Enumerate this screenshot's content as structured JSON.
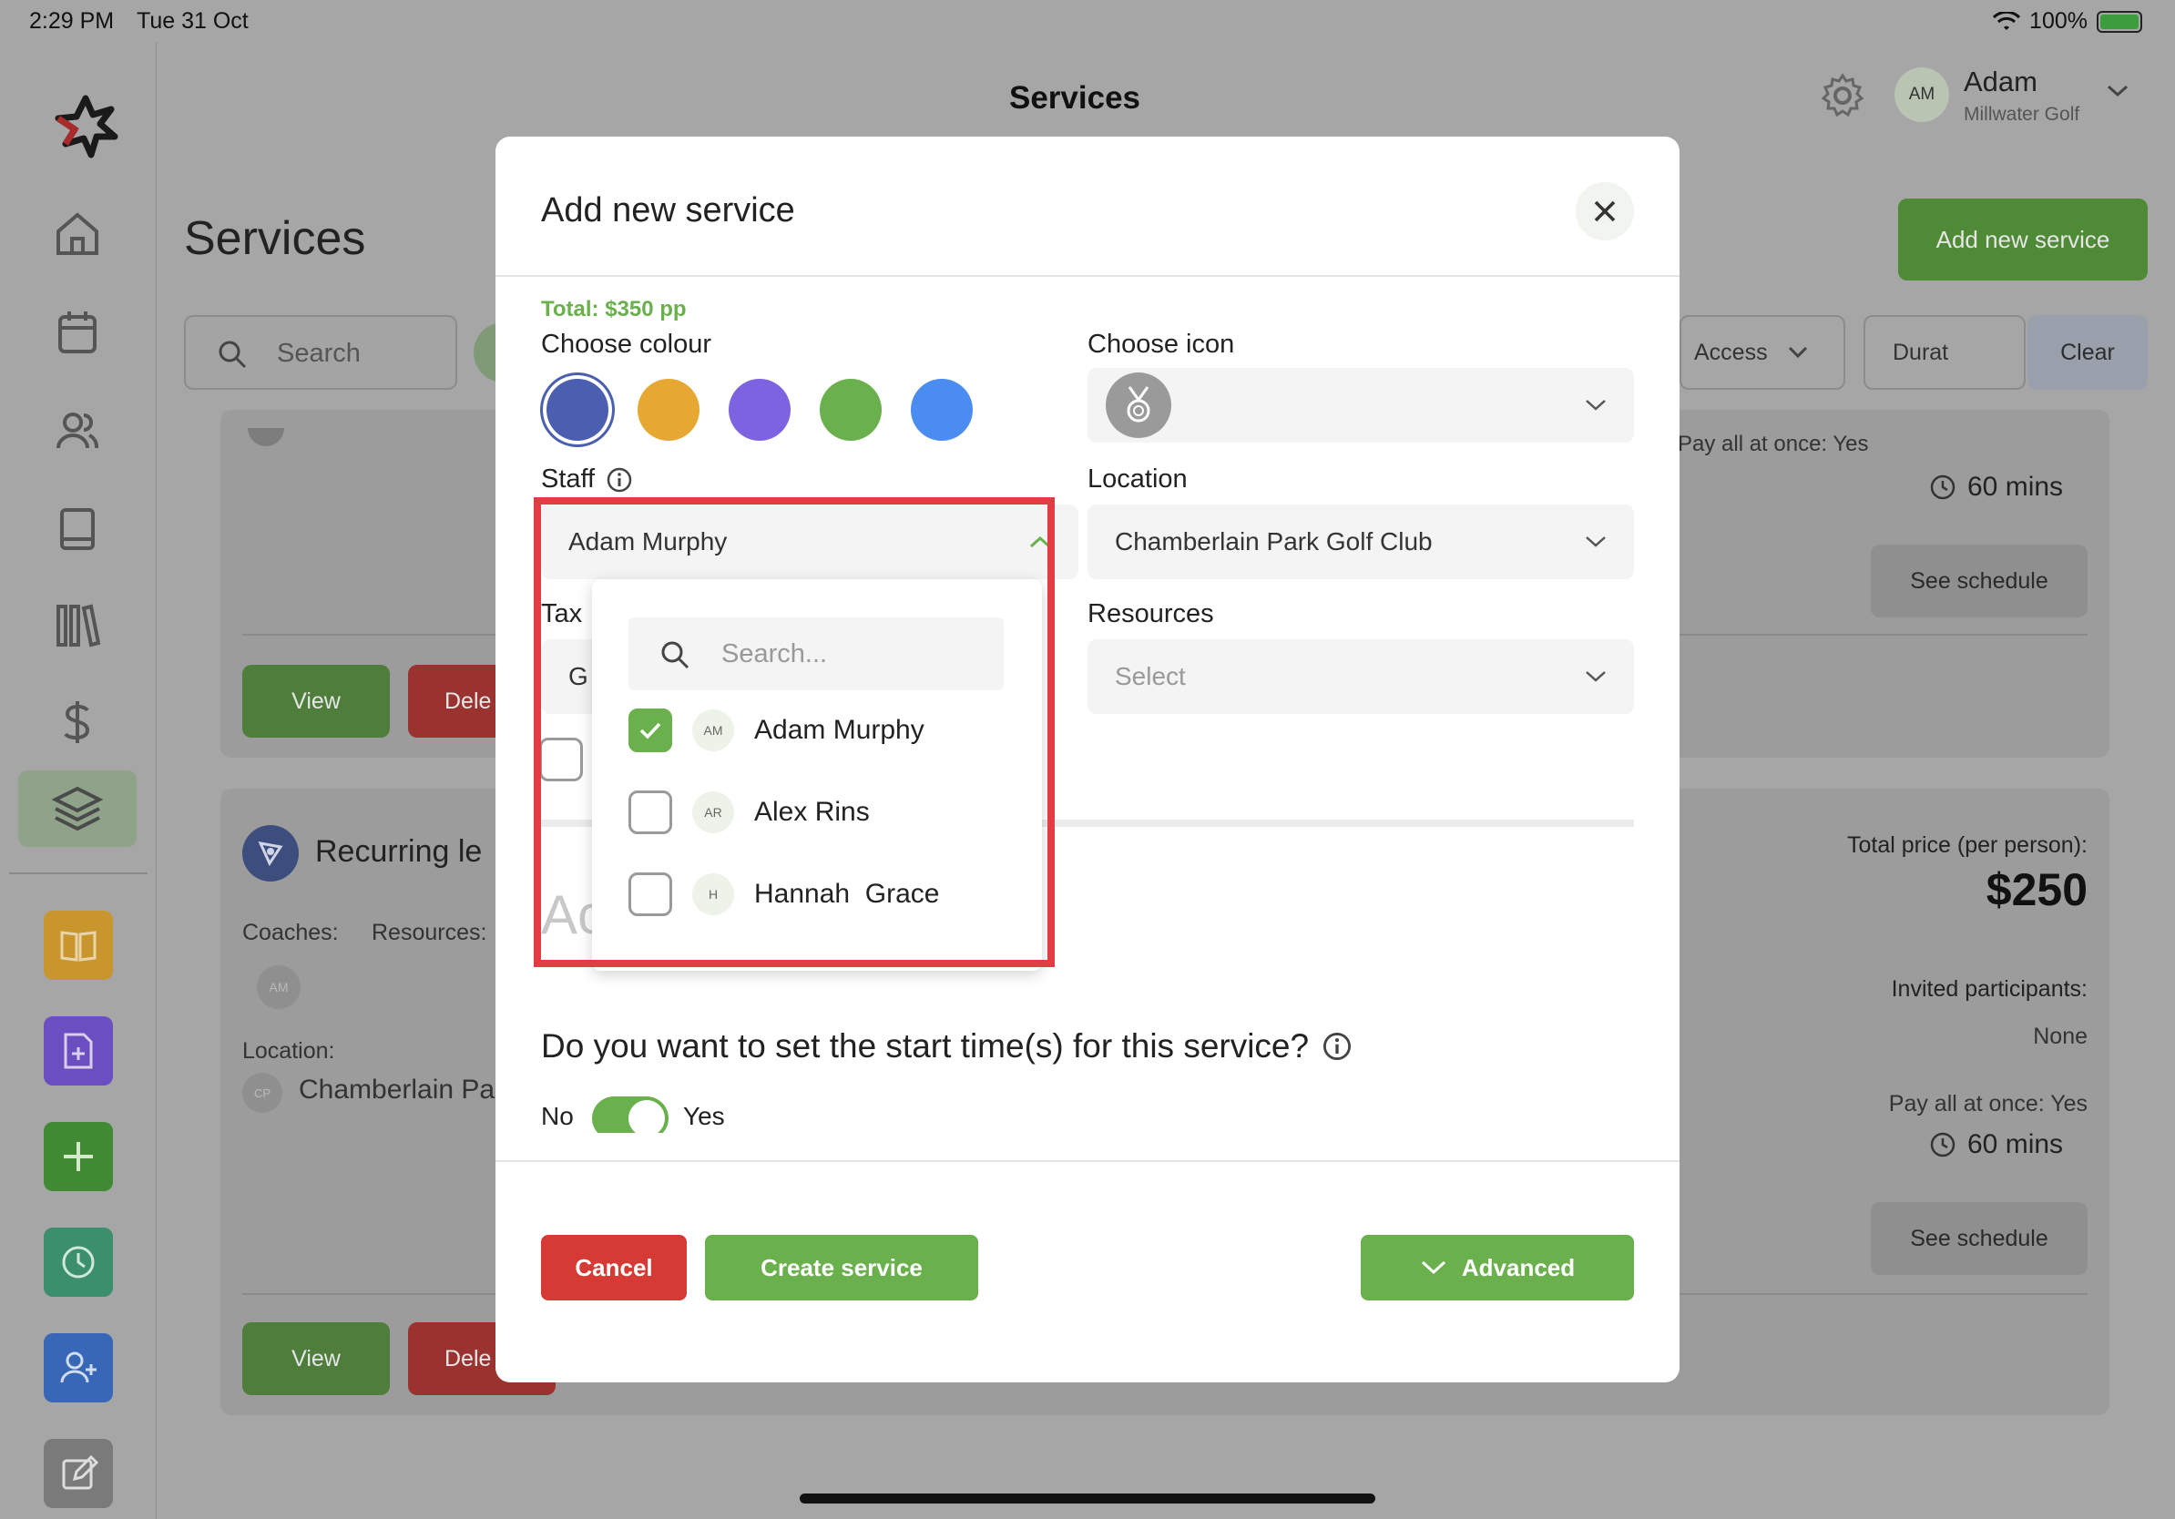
{
  "status_bar": {
    "time": "2:29 PM",
    "date": "Tue 31 Oct",
    "battery": "100%"
  },
  "sidebar": {
    "items": [
      "home-icon",
      "calendar-icon",
      "users-icon",
      "book-icon",
      "library-icon",
      "dollar-icon",
      "layers-icon"
    ],
    "quick_actions": [
      {
        "icon": "open-book-icon",
        "color": "#c8962c"
      },
      {
        "icon": "add-document-icon",
        "color": "#6b4fc0"
      },
      {
        "icon": "plus-icon",
        "color": "#3f8a32"
      },
      {
        "icon": "clock-icon",
        "color": "#3b8f6c"
      },
      {
        "icon": "add-user-icon",
        "color": "#3967b8"
      },
      {
        "icon": "edit-icon",
        "color": "#7a7a7a"
      }
    ]
  },
  "header": {
    "title": "Services",
    "user": {
      "initials": "AM",
      "name": "Adam",
      "org": "Millwater Golf"
    }
  },
  "background_page": {
    "title": "Services",
    "add_button": "Add new service",
    "search_placeholder": "Search",
    "filters": {
      "access": "Access",
      "duration": "Durat",
      "clear": "Clear"
    },
    "card1": {
      "pay_all": "Pay all at once: Yes",
      "duration": "60 mins",
      "see_schedule": "See schedule",
      "view": "View",
      "delete": "Dele"
    },
    "card2": {
      "title": "Recurring le",
      "coaches_label": "Coaches:",
      "resources_label": "Resources:",
      "coach_initials": "AM",
      "location_label": "Location:",
      "location_initials": "CP",
      "location": "Chamberlain Pa",
      "total_price_label": "Total price (per person):",
      "total_price": "$250",
      "invited_label": "Invited participants:",
      "invited_value": "None",
      "pay_all": "Pay all at once: Yes",
      "duration": "60 mins",
      "see_schedule": "See schedule",
      "view": "View",
      "delete": "Dele"
    }
  },
  "modal": {
    "title": "Add new service",
    "total": "Total: $350 pp",
    "choose_colour_label": "Choose colour",
    "colours": [
      "#4a5fb0",
      "#e6a832",
      "#7e63e0",
      "#6ab04c",
      "#4a8cf0"
    ],
    "selected_colour_index": 0,
    "choose_icon_label": "Choose icon",
    "staff_label": "Staff",
    "staff_value": "Adam Murphy",
    "location_label": "Location",
    "location_value": "Chamberlain Park Golf Club",
    "tax_label": "Tax",
    "tax_value_fragment": "G",
    "resources_label": "Resources",
    "resources_placeholder": "Select",
    "hidden_heading_fragment": "Ac",
    "start_time_question": "Do you want to set the start time(s) for this service?",
    "toggle_no": "No",
    "toggle_yes": "Yes",
    "toggle_on": true,
    "cancel": "Cancel",
    "create": "Create service",
    "advanced": "Advanced"
  },
  "staff_dropdown": {
    "search_placeholder": "Search...",
    "options": [
      {
        "initials": "AM",
        "name": "Adam Murphy",
        "checked": true
      },
      {
        "initials": "AR",
        "name": "Alex Rins",
        "checked": false
      },
      {
        "initials": "H",
        "name": "Hannah  Grace",
        "checked": false
      }
    ]
  },
  "colors": {
    "green": "#6ab04c",
    "red": "#d63a35",
    "highlight": "#e43c45"
  }
}
